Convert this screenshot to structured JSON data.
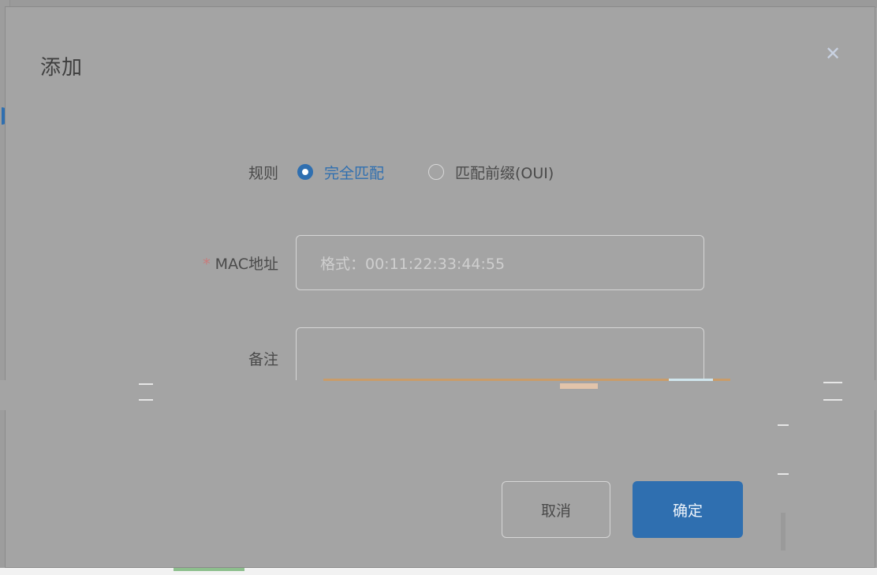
{
  "modal": {
    "title": "添加",
    "close_glyph": "✕"
  },
  "form": {
    "rule": {
      "label": "规则",
      "options": [
        {
          "label": "完全匹配",
          "selected": true
        },
        {
          "label": "匹配前缀(OUI)",
          "selected": false
        }
      ]
    },
    "mac": {
      "required_mark": "*",
      "label": "MAC地址",
      "placeholder": "格式：00:11:22:33:44:55"
    },
    "note": {
      "label": "备注",
      "value": ""
    }
  },
  "buttons": {
    "cancel": "取消",
    "confirm": "确定"
  },
  "colors": {
    "primary": "#2f6fb0",
    "overlay": "#a4a4a4",
    "required": "#c97b7b"
  },
  "icons": {
    "close": "close-icon",
    "radio_selected": "radio-selected-icon",
    "radio_unselected": "radio-unselected-icon"
  }
}
